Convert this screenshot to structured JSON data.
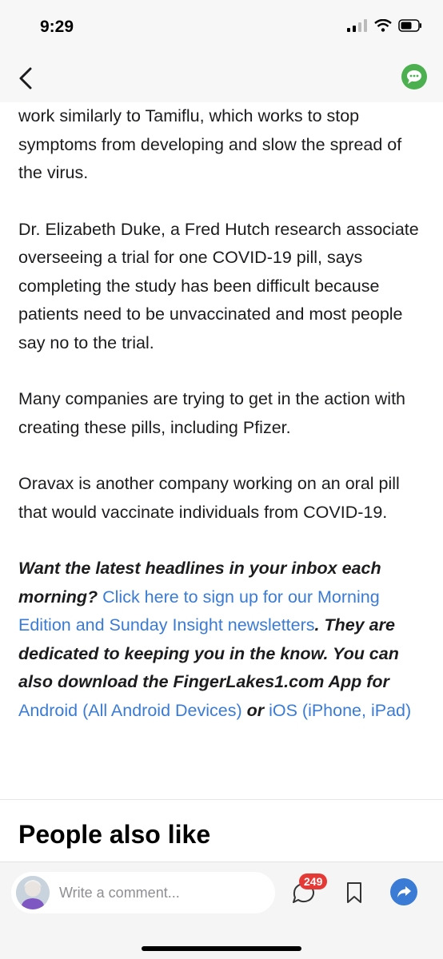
{
  "status": {
    "time": "9:29"
  },
  "nav": {
    "back_icon": "chevron-left-icon",
    "chat_icon": "chat-bubble-icon",
    "chat_color": "#4caf50"
  },
  "article": {
    "paragraphs": [
      "work similarly to Tamiflu, which works to stop symptoms from developing and slow the spread of the virus.",
      "Dr. Elizabeth Duke, a Fred Hutch research associate overseeing a trial for one COVID-19 pill, says completing the study has been difficult because patients need to be unvaccinated and most people say no to the trial.",
      "Many companies are trying to get in the action with creating these pills, including Pfizer.",
      "Oravax is another company working on an oral pill that would vaccinate individuals from COVID-19."
    ],
    "cta": {
      "lead": "Want the latest headlines in your inbox each morning? ",
      "link1": "Click here to sign up for our Morning Edition and Sunday Insight newsletters",
      "mid": ". They are dedicated to keeping you in the know. You can also download the FingerLakes1.com App for ",
      "link2": "Android (All Android Devices)",
      "or": " or ",
      "link3": "iOS (iPhone, iPad)",
      "link_color": "#3a7bd5"
    }
  },
  "section": {
    "title": "People also like"
  },
  "bottom_bar": {
    "comment_placeholder": "Write a comment...",
    "comment_count": "249",
    "badge_color": "#e53935",
    "share_color": "#3a7bd5"
  }
}
